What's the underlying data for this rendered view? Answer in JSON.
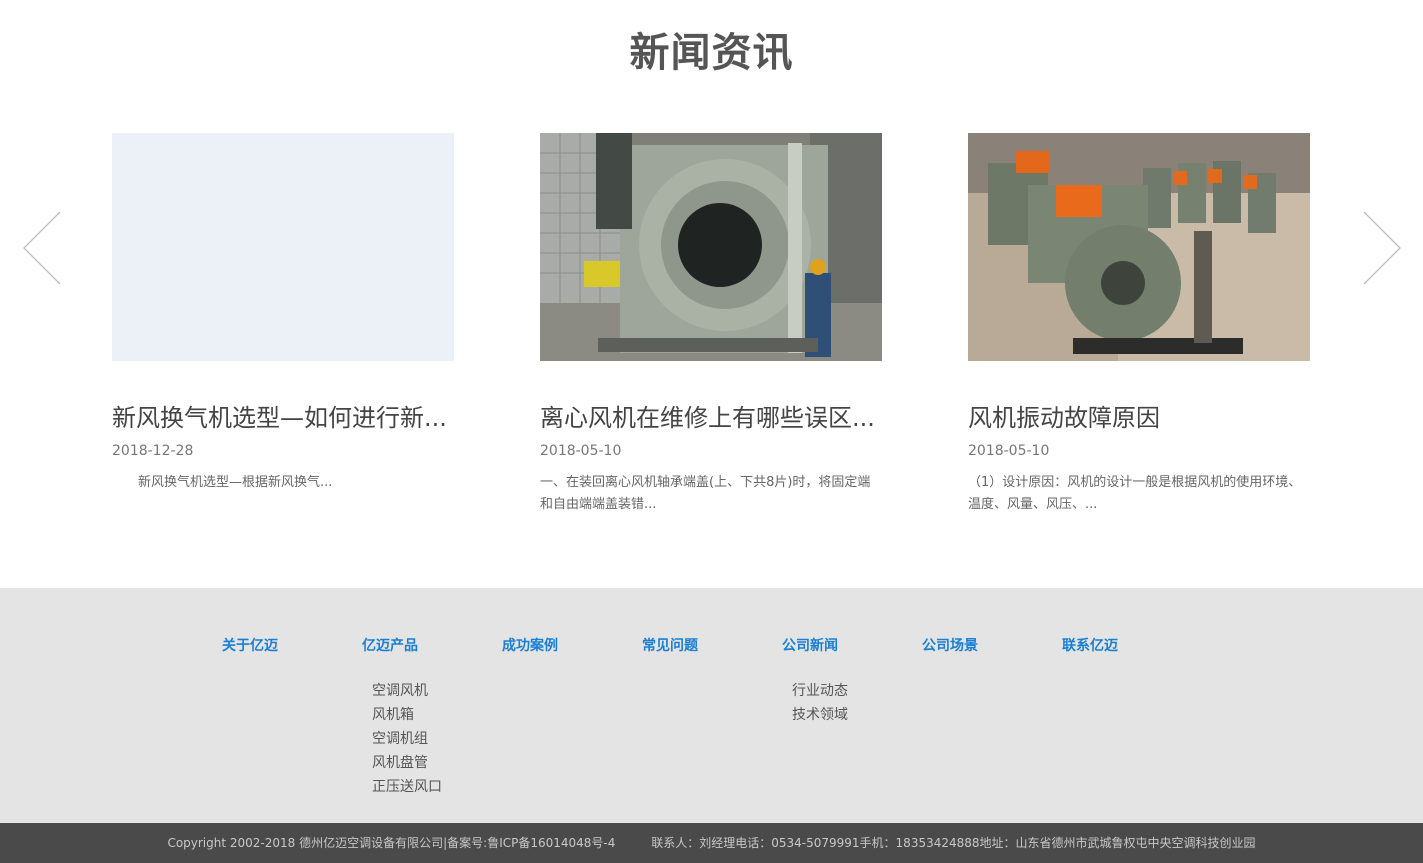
{
  "news": {
    "title": "新闻资讯",
    "cards": [
      {
        "title": "新风换气机选型—如何进行新...",
        "date": "2018-12-28",
        "summary": "新风换气机选型—根据新风换气..."
      },
      {
        "title": "离心风机在维修上有哪些误区...",
        "date": "2018-05-10",
        "summary": "一、在装回离心风机轴承端盖(上、下共8片)时，将固定端和自由端端盖装错..."
      },
      {
        "title": "风机振动故障原因",
        "date": "2018-05-10",
        "summary": "（1）设计原因：风机的设计一般是根据风机的使用环境、温度、风量、风压、..."
      }
    ]
  },
  "footer": {
    "columns": [
      {
        "label": "关于亿迈",
        "items": []
      },
      {
        "label": "亿迈产品",
        "items": [
          "空调风机",
          "风机箱",
          "空调机组",
          "风机盘管",
          "正压送风口"
        ]
      },
      {
        "label": "成功案例",
        "items": []
      },
      {
        "label": "常见问题",
        "items": []
      },
      {
        "label": "公司新闻",
        "items": [
          "行业动态",
          "技术领域"
        ]
      },
      {
        "label": "公司场景",
        "items": []
      },
      {
        "label": "联系亿迈",
        "items": []
      }
    ],
    "copyright": "Copyright 2002-2018 德州亿迈空调设备有限公司|备案号:鲁ICP备16014048号-4",
    "contact": "联系人：刘经理电话：0534-5079991手机：18353424888地址：山东省德州市武城鲁权屯中央空调科技创业园"
  },
  "colors": {
    "accent": "#1a7fd4",
    "footer_bg": "#e4e4e4",
    "copyright_bg": "#4a4a4a"
  }
}
